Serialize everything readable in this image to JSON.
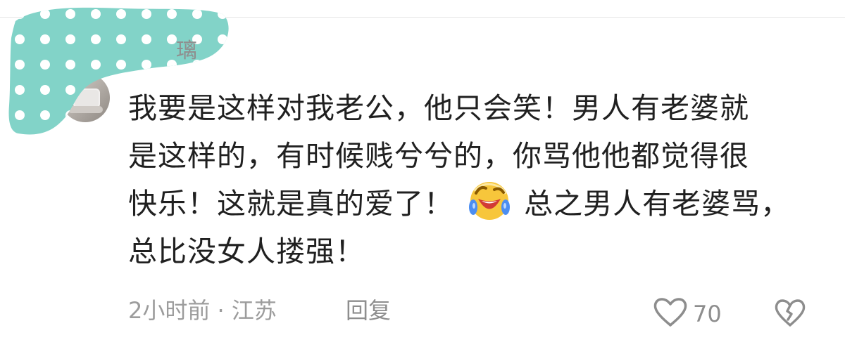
{
  "comment": {
    "username": "璃",
    "text_lines": [
      "我要是这样对我老公，他只会笑！男人有老婆就",
      "是这样的，有时候贱兮兮的，你骂他他都觉得很",
      "快乐！这就是真的爱了！",
      "总之男人有老婆骂，",
      "总比没女人搂强！"
    ],
    "emoji": "laughing-crying-face-emoji",
    "time_location": "2小时前 · 江苏",
    "reply_label": "回复",
    "like_count": "70"
  },
  "icons": {
    "like": "heart-outline-icon",
    "dislike": "broken-heart-icon"
  },
  "colors": {
    "text": "#202020",
    "meta": "#9c9c9c",
    "redaction_fill": "#82d3c8"
  }
}
